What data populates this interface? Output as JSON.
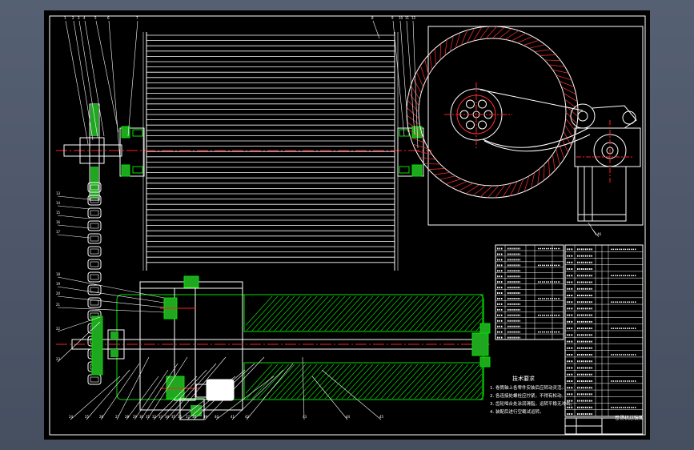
{
  "app": {
    "background_color": "#4a5466",
    "canvas_color": "#000000"
  },
  "colors": {
    "line": "#ffffff",
    "centerline": "#ff2020",
    "hatch": "#00e000",
    "section_fill": "#1fa81f",
    "leader": "#ffffff"
  },
  "callouts": {
    "top_left": [
      "1",
      "2",
      "3",
      "4",
      "5",
      "6",
      "7"
    ],
    "top_right": [
      "8",
      "9",
      "10",
      "11",
      "12"
    ],
    "left_chain": [
      "13",
      "14",
      "15",
      "16",
      "17"
    ],
    "left_lower": [
      "18",
      "19",
      "20",
      "21",
      "22",
      "23"
    ],
    "bottom": [
      "24",
      "25",
      "26",
      "27",
      "28",
      "29",
      "30",
      "31",
      "32",
      "33",
      "34",
      "35",
      "36",
      "37",
      "38",
      "39",
      "40",
      "41",
      "42",
      "43",
      "44",
      "45"
    ],
    "right_view": [
      "46"
    ]
  },
  "tech_notes": {
    "heading": "技术要求",
    "lines": [
      "1. 卷筒轴上各零件安装后应转动灵活。",
      "2. 各连接处螺栓应拧紧，不得有松动。",
      "3. 齿轮啮合处涂润滑脂，运转平稳无冲击。",
      "4. 装配后进行空载试运转。"
    ]
  },
  "parts_table": {
    "left_rows": 17,
    "right_rows": 26
  },
  "title_block": {
    "title": "卷扬机总装图"
  }
}
